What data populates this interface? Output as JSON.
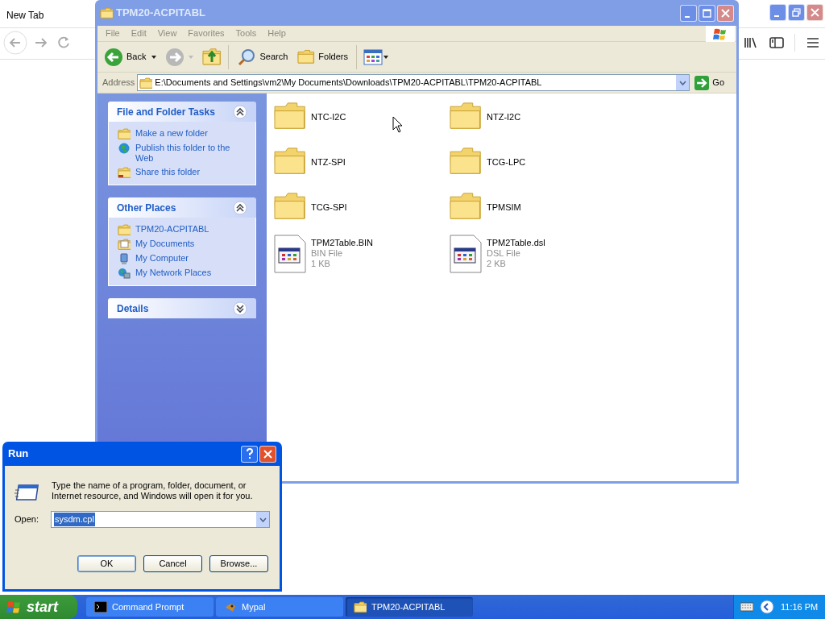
{
  "browser": {
    "tab": "New Tab"
  },
  "explorer": {
    "title": "TPM20-ACPITABL",
    "menu": [
      "File",
      "Edit",
      "View",
      "Favorites",
      "Tools",
      "Help"
    ],
    "toolbar": {
      "back": "Back",
      "search": "Search",
      "folders": "Folders"
    },
    "address": {
      "label": "Address",
      "value": "E:\\Documents and Settings\\vm2\\My Documents\\Downloads\\TPM20-ACPITABL\\TPM20-ACPITABL",
      "go": "Go"
    },
    "panels": [
      {
        "title": "File and Folder Tasks",
        "expanded": true,
        "items": [
          {
            "kind": "new-folder",
            "label": "Make a new folder"
          },
          {
            "kind": "globe",
            "label": "Publish this folder to the Web"
          },
          {
            "kind": "share",
            "label": "Share this folder"
          }
        ]
      },
      {
        "title": "Other Places",
        "expanded": true,
        "items": [
          {
            "kind": "folder",
            "label": "TPM20-ACPITABL"
          },
          {
            "kind": "documents",
            "label": "My Documents"
          },
          {
            "kind": "computer",
            "label": "My Computer"
          },
          {
            "kind": "network",
            "label": "My Network Places"
          }
        ]
      },
      {
        "title": "Details",
        "expanded": false
      }
    ],
    "items": [
      {
        "kind": "folder",
        "name": "NTC-I2C"
      },
      {
        "kind": "folder",
        "name": "NTZ-I2C"
      },
      {
        "kind": "folder",
        "name": "NTZ-SPI"
      },
      {
        "kind": "folder",
        "name": "TCG-LPC"
      },
      {
        "kind": "folder",
        "name": "TCG-SPI"
      },
      {
        "kind": "folder",
        "name": "TPMSIM"
      },
      {
        "kind": "file",
        "name": "TPM2Table.BIN",
        "type": "BIN File",
        "size": "1 KB"
      },
      {
        "kind": "file",
        "name": "TPM2Table.dsl",
        "type": "DSL File",
        "size": "2 KB"
      }
    ]
  },
  "run_dialog": {
    "title": "Run",
    "message": "Type the name of a program, folder, document, or Internet resource, and Windows will open it for you.",
    "open_label": "Open:",
    "value": "sysdm.cpl",
    "buttons": [
      "OK",
      "Cancel",
      "Browse..."
    ]
  },
  "taskbar": {
    "start": "start",
    "tasks": [
      {
        "kind": "console",
        "label": "Command Prompt",
        "selected": false
      },
      {
        "kind": "app",
        "label": "Mypal",
        "selected": false
      },
      {
        "kind": "folder",
        "label": "TPM20-ACPITABL",
        "selected": true
      }
    ],
    "clock": "11:16 PM"
  }
}
